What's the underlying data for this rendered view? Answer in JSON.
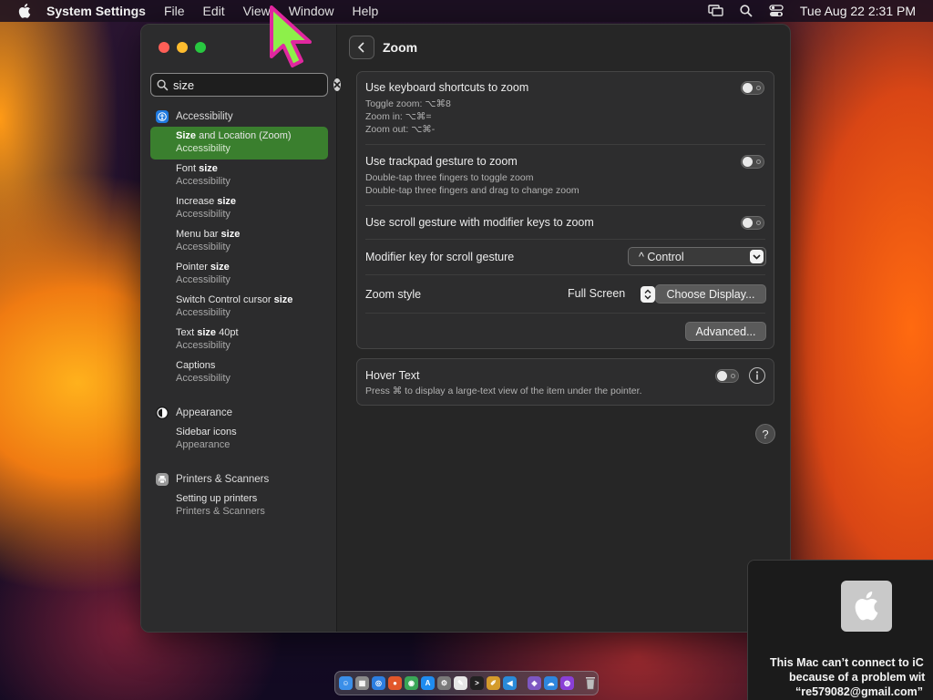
{
  "menubar": {
    "app_name": "System Settings",
    "menus": [
      "File",
      "Edit",
      "View",
      "Window",
      "Help"
    ],
    "clock": "Tue Aug 22  2:31 PM"
  },
  "sidebar": {
    "search": {
      "value": "size",
      "placeholder": "Search"
    },
    "groups": [
      {
        "title": "Accessibility",
        "icon": "accessibility-icon",
        "color": "#1f7ae0",
        "results": [
          {
            "title_pre": "",
            "title_bold": "Size",
            "title_post": " and Location (Zoom)",
            "sub": "Accessibility",
            "selected": true
          },
          {
            "title_pre": "Font ",
            "title_bold": "size",
            "title_post": "",
            "sub": "Accessibility"
          },
          {
            "title_pre": "Increase ",
            "title_bold": "size",
            "title_post": "",
            "sub": "Accessibility"
          },
          {
            "title_pre": "Menu bar ",
            "title_bold": "size",
            "title_post": "",
            "sub": "Accessibility"
          },
          {
            "title_pre": "Pointer ",
            "title_bold": "size",
            "title_post": "",
            "sub": "Accessibility"
          },
          {
            "title_pre": "Switch Control cursor ",
            "title_bold": "size",
            "title_post": "",
            "sub": "Accessibility"
          },
          {
            "title_pre": "Text ",
            "title_bold": "size",
            "title_post": " 40pt",
            "sub": "Accessibility"
          },
          {
            "title_pre": "Captions",
            "title_bold": "",
            "title_post": "",
            "sub": "Accessibility"
          }
        ]
      },
      {
        "title": "Appearance",
        "icon": "appearance-icon",
        "color": "#1a1a1a",
        "results": [
          {
            "title_pre": "Sidebar icons",
            "title_bold": "",
            "title_post": "",
            "sub": "Appearance"
          }
        ]
      },
      {
        "title": "Printers & Scanners",
        "icon": "printer-icon",
        "color": "#9a9a9a",
        "results": [
          {
            "title_pre": "Setting up printers",
            "title_bold": "",
            "title_post": "",
            "sub": "Printers & Scanners"
          }
        ]
      }
    ]
  },
  "main": {
    "title": "Zoom",
    "zoom_card": {
      "keyboard": {
        "label": "Use keyboard shortcuts to zoom",
        "lines": [
          "Toggle zoom: ⌥⌘8",
          "Zoom in: ⌥⌘=",
          "Zoom out: ⌥⌘-"
        ],
        "enabled": false
      },
      "trackpad": {
        "label": "Use trackpad gesture to zoom",
        "lines": [
          "Double-tap three fingers to toggle zoom",
          "Double-tap three fingers and drag to change zoom"
        ],
        "enabled": false
      },
      "scroll": {
        "label": "Use scroll gesture with modifier keys to zoom",
        "enabled": false
      },
      "modifier": {
        "label": "Modifier key for scroll gesture",
        "value": "^ Control"
      },
      "style": {
        "label": "Zoom style",
        "value": "Full Screen",
        "choose_button": "Choose Display..."
      },
      "advanced_button": "Advanced..."
    },
    "hover_card": {
      "label": "Hover Text",
      "desc": "Press ⌘ to display a large-text view of the item under the pointer.",
      "enabled": false
    },
    "help": "?"
  },
  "notification": {
    "lines": [
      "This Mac can’t connect to iC",
      "because of a problem wit",
      "“re579082@gmail.com”"
    ]
  },
  "dock": {
    "apps": [
      {
        "name": "finder-icon",
        "color": "#3b8fe8",
        "glyph": "☺"
      },
      {
        "name": "launchpad-icon",
        "color": "#8a8a8a",
        "glyph": "▦"
      },
      {
        "name": "safari-icon",
        "color": "#2d7ee0",
        "glyph": "◎"
      },
      {
        "name": "firefox-icon",
        "color": "#e2572a",
        "glyph": "●"
      },
      {
        "name": "chrome-icon",
        "color": "#3aa757",
        "glyph": "◉"
      },
      {
        "name": "app-store-icon",
        "color": "#1f8cf0",
        "glyph": "A"
      },
      {
        "name": "system-settings-icon",
        "color": "#7a7a7a",
        "glyph": "⚙"
      },
      {
        "name": "textedit-icon",
        "color": "#e6e6e6",
        "glyph": "✎"
      },
      {
        "name": "terminal-icon",
        "color": "#222222",
        "glyph": ">"
      },
      {
        "name": "paintbrush-icon",
        "color": "#d49b2b",
        "glyph": "✐"
      },
      {
        "name": "vscode-icon",
        "color": "#2a8ad8",
        "glyph": "◀"
      }
    ],
    "recent": [
      {
        "name": "vs-icon",
        "color": "#7d57c2",
        "glyph": "◈"
      },
      {
        "name": "onedrive-icon",
        "color": "#2e86de",
        "glyph": "☁"
      },
      {
        "name": "podcast-icon",
        "color": "#8a3fd6",
        "glyph": "◍"
      }
    ],
    "trash": {
      "name": "trash-icon",
      "color": "#b9b9b9"
    }
  }
}
